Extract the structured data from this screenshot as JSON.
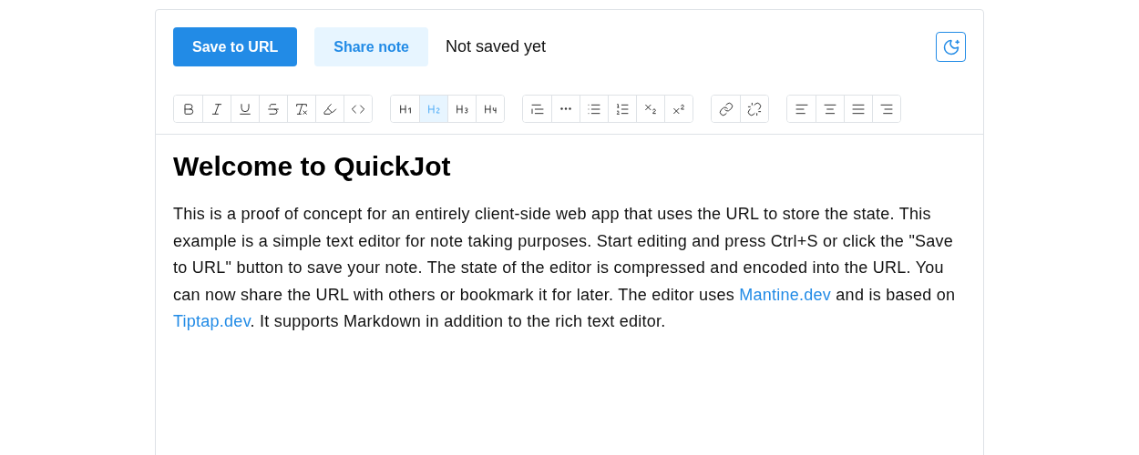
{
  "header": {
    "buttons": [
      {
        "label": "Save to URL",
        "kind": "primary"
      },
      {
        "label": "Share note",
        "kind": "light"
      }
    ],
    "status": "Not saved yet",
    "theme_toggle": {
      "kind": "moon"
    }
  },
  "toolbar": [
    [
      {
        "kind": "bold",
        "selected": false
      },
      {
        "kind": "italic",
        "selected": false
      },
      {
        "kind": "underline",
        "selected": false
      },
      {
        "kind": "strike",
        "selected": false
      },
      {
        "kind": "clear",
        "selected": false
      },
      {
        "kind": "highlight",
        "selected": false
      },
      {
        "kind": "code",
        "selected": false
      }
    ],
    [
      {
        "kind": "h1",
        "selected": false
      },
      {
        "kind": "h2",
        "selected": true
      },
      {
        "kind": "h3",
        "selected": false
      },
      {
        "kind": "h4",
        "selected": false
      }
    ],
    [
      {
        "kind": "quote",
        "selected": false
      },
      {
        "kind": "rule",
        "selected": false
      },
      {
        "kind": "bullets",
        "selected": false
      },
      {
        "kind": "numbers",
        "selected": false
      },
      {
        "kind": "sub",
        "selected": false
      },
      {
        "kind": "sup",
        "selected": false
      }
    ],
    [
      {
        "kind": "link",
        "selected": false
      },
      {
        "kind": "unlink",
        "selected": false
      }
    ],
    [
      {
        "kind": "left",
        "selected": false
      },
      {
        "kind": "center",
        "selected": false
      },
      {
        "kind": "justify",
        "selected": false
      },
      {
        "kind": "right",
        "selected": false
      }
    ]
  ],
  "document": {
    "title": "Welcome to QuickJot",
    "paragraph": [
      {
        "kind": "text",
        "text": "This is a proof of concept for an entirely client-side web app that uses the URL to store the state. This example is a simple text editor for note taking purposes. Start editing and press Ctrl+S or click the \"Save to URL\" button to save your note. The state of the editor is compressed and encoded into the URL. You can now share the URL with others or bookmark it for later. The editor uses "
      },
      {
        "kind": "link",
        "text": "Mantine.dev"
      },
      {
        "kind": "text",
        "text": " and is based on "
      },
      {
        "kind": "link",
        "text": "Tiptap.dev"
      },
      {
        "kind": "text",
        "text": ". It supports Markdown in addition to the rich text editor."
      }
    ]
  }
}
